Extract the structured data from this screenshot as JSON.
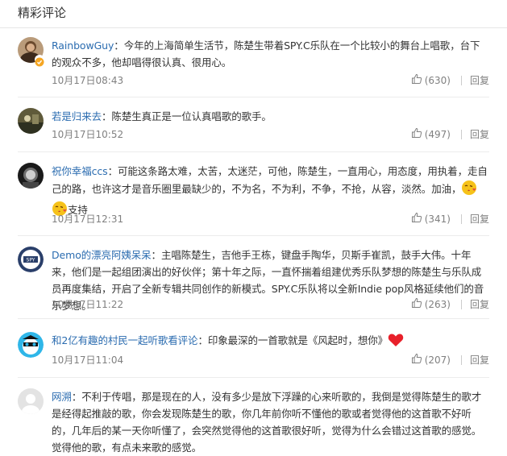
{
  "section_title": "精彩评论",
  "comments": [
    {
      "user": "RainbowGuy",
      "text": "今年的上海简单生活节，陈楚生带着SPY.C乐队在一个比较小的舞台上唱歌，台下的观众不多，他却唱得很认真、很用心。",
      "time": "10月17日08:43",
      "likes": "(630)",
      "reply": "回复"
    },
    {
      "user": "若是归来去",
      "text": "陈楚生真正是一位认真唱歌的歌手。",
      "time": "10月17日10:52",
      "likes": "(497)",
      "reply": "回复"
    },
    {
      "user": "祝你幸福ccs",
      "text": "可能这条路太难，太苦，太迷茫，可他，陈楚生，一直用心，用态度，用执着，走自己的路，也许这才是音乐圈里最缺少的，不为名，不为利，不争，不抢，从容，淡然。加油，",
      "text2": "支持",
      "time": "10月17日12:31",
      "likes": "(341)",
      "reply": "回复"
    },
    {
      "user": "Demo的漂亮阿姨呆呆",
      "text": "主唱陈楚生，吉他手王栋，键盘手陶华，贝斯手崔凯，鼓手大伟。十年来，他们是一起组团演出的好伙伴；第十年之际，一直怀揣着组建优秀乐队梦想的陈楚生与乐队成员再度集结，开启了全新专辑共同创作的新模式。SPY.C乐队将以全新Indie pop风格延续他们的音乐梦想。",
      "time": "10月17日11:22",
      "likes": "(263)",
      "reply": "回复"
    },
    {
      "user": "和2亿有趣的村民一起听歌看评论",
      "text": "印象最深的一首歌就是《风起时，想你》",
      "time": "10月17日11:04",
      "likes": "(207)",
      "reply": "回复"
    },
    {
      "user": "网溯",
      "text": "不利于传唱，那是现在的人，没有多少是放下浮躁的心来听歌的，我倒是觉得陈楚生的歌才是经得起推敲的歌，你会发现陈楚生的歌，你几年前你听不懂他的歌或者觉得他的这首歌不好听的，几年后的某一天你听懂了，会突然觉得他的这首歌很好听，觉得为什么会错过这首歌的感觉。觉得他的歌，有点未来歌的感觉。"
    }
  ],
  "colors": {
    "username": "#2b6cb0",
    "text": "#333333",
    "meta": "#808080"
  },
  "icons": [
    "thumbs-up-icon",
    "verified-badge-icon",
    "kiss-emoji-icon",
    "heart-emoji-icon"
  ]
}
